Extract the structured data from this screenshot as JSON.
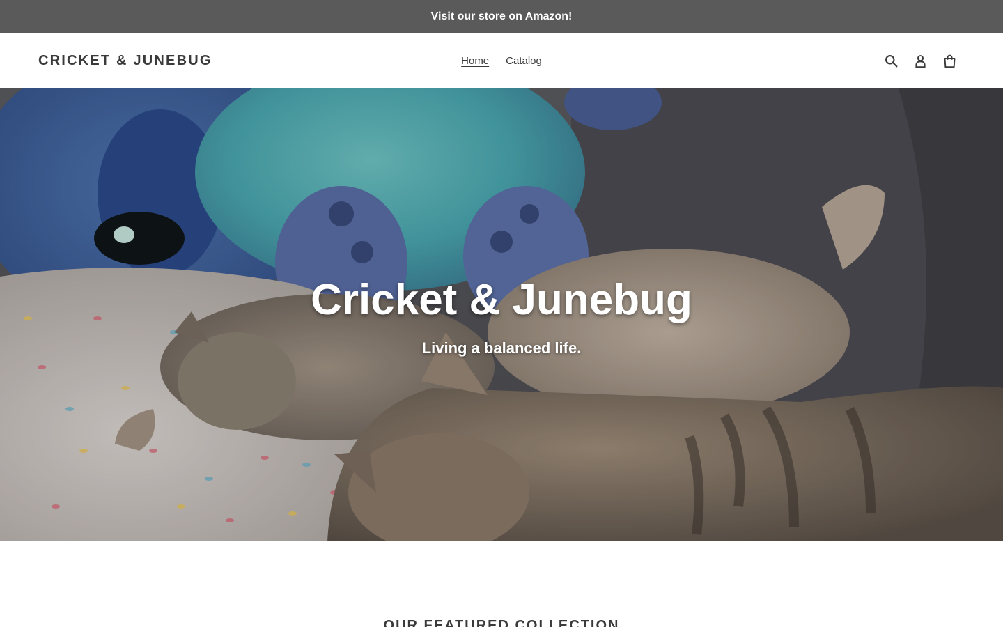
{
  "announcement": {
    "text": "Visit our store on Amazon!"
  },
  "header": {
    "logo": "CRICKET & JUNEBUG",
    "nav": [
      {
        "label": "Home",
        "active": true
      },
      {
        "label": "Catalog",
        "active": false
      }
    ],
    "icons": [
      "search-icon",
      "account-icon",
      "cart-icon"
    ]
  },
  "hero": {
    "title": "Cricket & Junebug",
    "subtitle": "Living a balanced life."
  },
  "featured": {
    "heading": "OUR FEATURED COLLECTION"
  },
  "colors": {
    "announcement_bg": "#5a5a5a",
    "text": "#3a3a3a",
    "header_bg": "#ffffff"
  }
}
